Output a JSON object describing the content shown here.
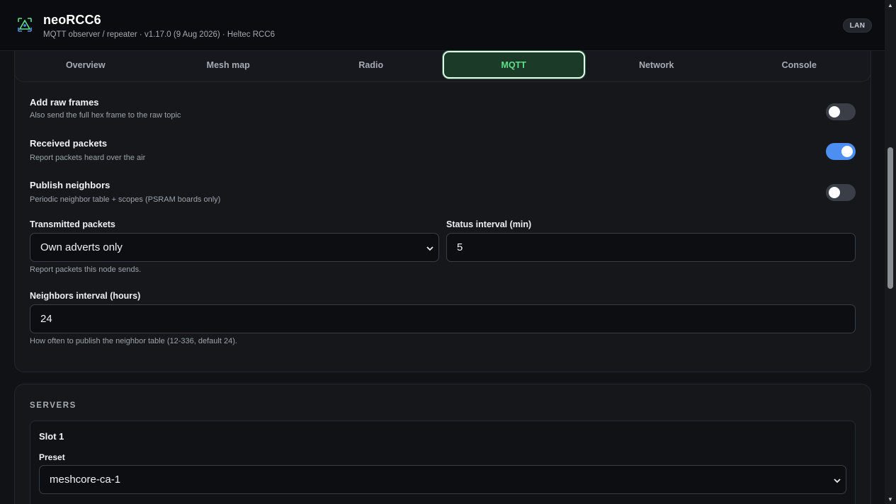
{
  "header": {
    "title": "neoRCC6",
    "subtitle": "MQTT observer / repeater · v1.17.0 (9 Aug 2026) · Heltec RCC6",
    "badge": "LAN",
    "logo_icon": "triangle-logo-icon"
  },
  "tabs": [
    {
      "label": "Overview",
      "active": false
    },
    {
      "label": "Mesh map",
      "active": false
    },
    {
      "label": "Radio",
      "active": false
    },
    {
      "label": "MQTT",
      "active": true
    },
    {
      "label": "Network",
      "active": false
    },
    {
      "label": "Console",
      "active": false
    }
  ],
  "settings": {
    "toggles": [
      {
        "title": "Add raw frames",
        "description": "Also send the full hex frame to the raw topic",
        "on": false
      },
      {
        "title": "Received packets",
        "description": "Report packets heard over the air",
        "on": true
      },
      {
        "title": "Publish neighbors",
        "description": "Periodic neighbor table + scopes (PSRAM boards only)",
        "on": false
      }
    ],
    "transmitted_packets": {
      "label": "Transmitted packets",
      "value": "Own adverts only",
      "help": "Report packets this node sends."
    },
    "status_interval": {
      "label": "Status interval (min)",
      "value": "5"
    },
    "neighbors_interval": {
      "label": "Neighbors interval (hours)",
      "value": "24",
      "help": "How often to publish the neighbor table (12-336, default 24)."
    }
  },
  "servers": {
    "heading": "SERVERS",
    "slots": [
      {
        "title": "Slot 1",
        "preset_label": "Preset",
        "preset_value": "meshcore-ca-1"
      }
    ]
  },
  "colors": {
    "accent_green": "#5fe08a",
    "toggle_on": "#4d8ff0",
    "background": "#101216"
  }
}
